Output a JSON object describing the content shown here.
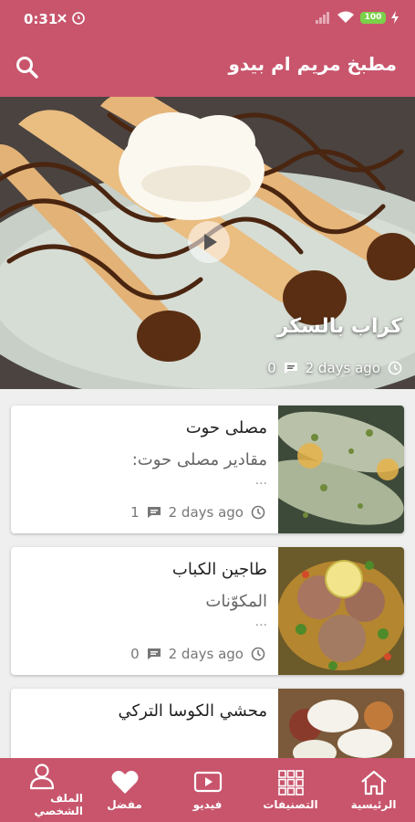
{
  "status_bar": {
    "time": "0:31",
    "battery": "100"
  },
  "app_bar": {
    "title": "مطبخ مريم ام بيدو",
    "search_icon": "search-icon"
  },
  "hero": {
    "title": "كراب بالسكر",
    "time": "2 days ago",
    "comments": "0"
  },
  "recipes": [
    {
      "title": "مصلى حوت",
      "subtitle": "مقادير مصلى حوت:",
      "ellipsis": "...",
      "time": "2 days ago",
      "comments": "1"
    },
    {
      "title": "طاجين الكباب",
      "subtitle": "المكوّنات",
      "ellipsis": "...",
      "time": "2 days ago",
      "comments": "0"
    },
    {
      "title": "محشي الكوسا التركي"
    }
  ],
  "bottom_nav": [
    {
      "label": "الرئيسية",
      "icon": "home-icon"
    },
    {
      "label": "التصنيفات",
      "icon": "grid-icon"
    },
    {
      "label": "فيديو",
      "icon": "video-icon"
    },
    {
      "label": "مفضل",
      "icon": "heart-icon"
    },
    {
      "label": "الملف الشخصي",
      "icon": "user-icon"
    }
  ],
  "colors": {
    "primary": "#c8556c"
  }
}
